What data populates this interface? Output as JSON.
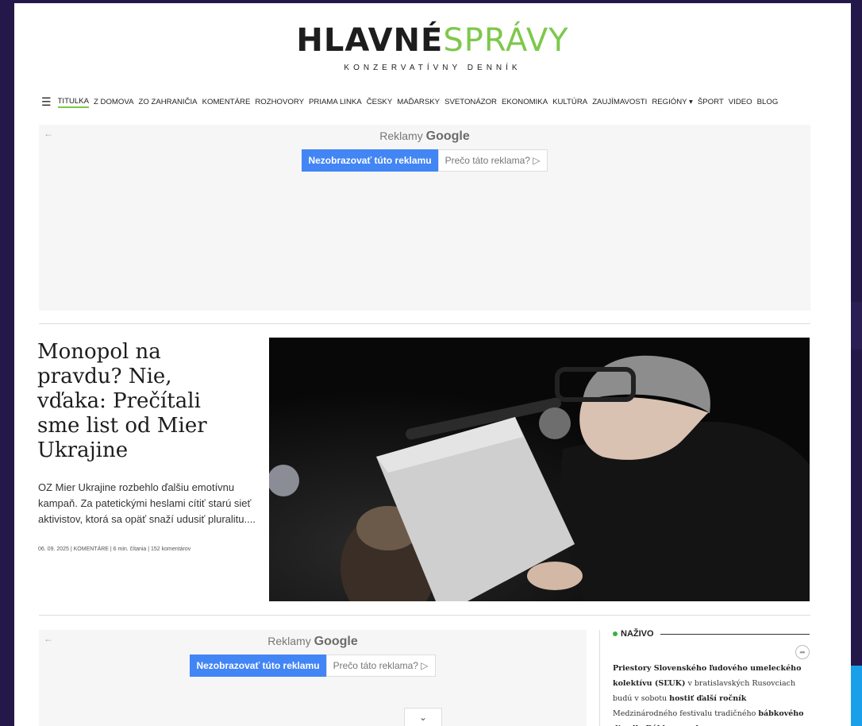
{
  "logo": {
    "part1": "HLAVNÉ",
    "part2": "SPRÁVY",
    "subtitle": "KONZERVATÍVNY DENNÍK"
  },
  "colors": {
    "accent": "#7ec84a",
    "ad_button": "#4285f4",
    "live_dot": "#3cb043",
    "backdrop": "#24184a"
  },
  "nav": {
    "menu_icon": "hamburger-menu-icon",
    "items": [
      "TITULKA",
      "Z DOMOVA",
      "ZO ZAHRANIČIA",
      "KOMENTÁRE",
      "ROZHOVORY",
      "PRIAMA LINKA",
      "ČESKY",
      "MAĎARSKY",
      "SVETONÁZOR",
      "EKONOMIKA",
      "KULTÚRA",
      "ZAUJÍMAVOSTI",
      "REGIÓNY ▾",
      "ŠPORT",
      "VIDEO",
      "BLOG"
    ],
    "active": "TITULKA"
  },
  "ads": {
    "back_icon": "←",
    "label_prefix": "Reklamy",
    "label_brand": "Google",
    "hide_button": "Nezobrazovať túto reklamu",
    "why_button": "Prečo táto reklama? ▷"
  },
  "article": {
    "title": "Monopol na pravdu? Nie, vďaka: Prečítali sme list od Mier Ukrajine",
    "excerpt": "OZ Mier Ukrajine rozbehlo ďalšiu emotívnu kampaň. Za patetickými heslami cítiť starú sieť aktivistov, ktorá sa opäť snaží udusiť pluralitu....",
    "meta": "06. 09. 2025 | KOMENTÁRE | 6 min. čítania | 152 komentárov"
  },
  "live": {
    "title": "NAŽIVO",
    "share_icon": "share-icon",
    "text_parts": [
      {
        "text": "Priestory Slovenského ľudového umeleckého kolektívu (SĽUK)",
        "bold": true
      },
      {
        "text": " v bratislavských Rusovciach budú v sobotu ",
        "bold": false
      },
      {
        "text": "hostiť ďalší ročník",
        "bold": true
      },
      {
        "text": " Medzinárodného festivalu tradičného ",
        "bold": false
      },
      {
        "text": "bábkového divadla Bábky v parku",
        "bold": true
      }
    ]
  },
  "scroll_toggle": "⌄"
}
